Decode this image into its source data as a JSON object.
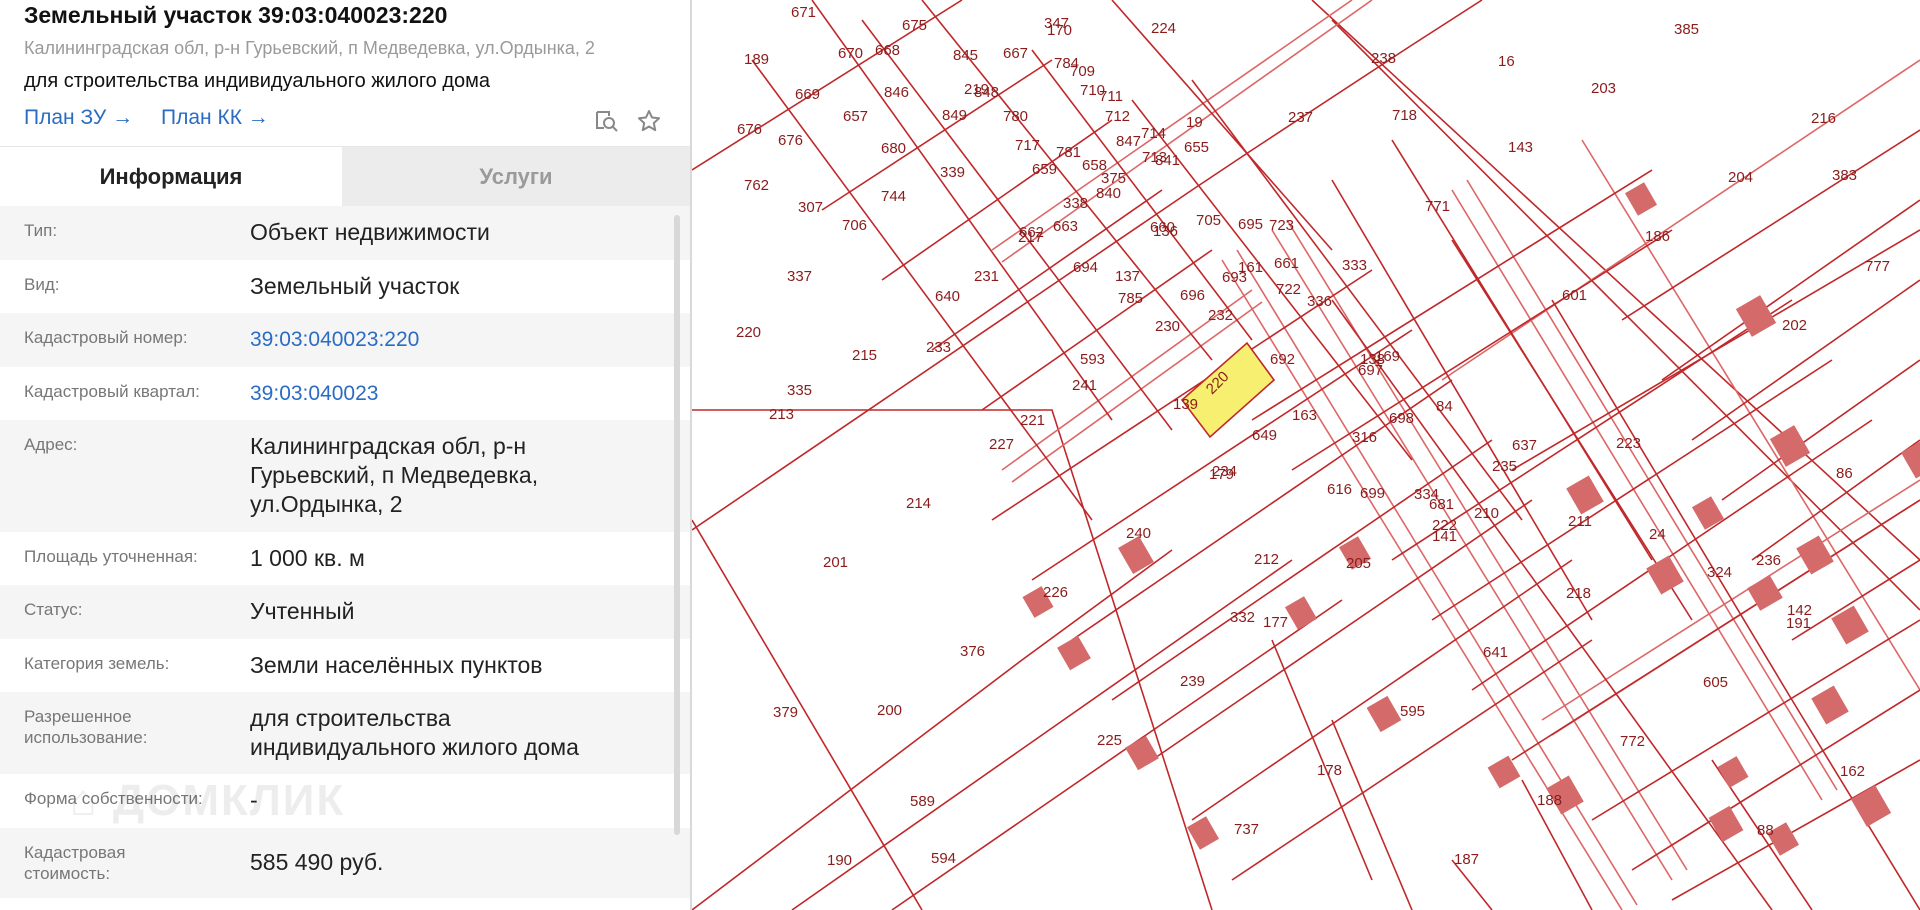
{
  "header": {
    "title": "Земельный участок 39:03:040023:220",
    "address": "Калининградская обл, р-н Гурьевский, п Медведевка, ул.Ордынка, 2",
    "purpose": "для строительства индивидуального жилого дома",
    "plan_zu": "План ЗУ",
    "plan_kk": "План КК"
  },
  "tabs": [
    "Информация",
    "Услуги"
  ],
  "info": [
    {
      "label": "Тип:",
      "value": "Объект недвижимости"
    },
    {
      "label": "Вид:",
      "value": "Земельный участок"
    },
    {
      "label": "Кадастровый номер:",
      "value": "39:03:040023:220"
    },
    {
      "label": "Кадастровый квартал:",
      "value": "39:03:040023"
    },
    {
      "label": "Адрес:",
      "value": "Калининградская обл, р-н Гурьевский, п Медведевка, ул.Ордынка, 2"
    },
    {
      "label": "Площадь уточненная:",
      "value": "1 000 кв. м"
    },
    {
      "label": "Статус:",
      "value": "Учтенный"
    },
    {
      "label": "Категория земель:",
      "value": "Земли населённых пунктов"
    },
    {
      "label": "Разрешенное использование:",
      "value": "для строительства индивидуального жилого дома"
    },
    {
      "label": "Форма собственности:",
      "value": "-"
    },
    {
      "label": "Кадастровая стоимость:",
      "value": "585 490 руб."
    }
  ],
  "watermark": "ДОМКЛИК",
  "icons": [
    "search-doc-icon",
    "star-icon",
    "arrow-right-icon"
  ],
  "colors": {
    "link": "#2a6cc4",
    "boundary": "#c0282a",
    "highlight": "#f7ef6f"
  },
  "map": {
    "selected": "220",
    "plots": [
      "671",
      "675",
      "347",
      "670",
      "668",
      "845",
      "667",
      "784",
      "709",
      "16",
      "669",
      "846",
      "848",
      "710",
      "711",
      "19",
      "676",
      "676",
      "657",
      "849",
      "780",
      "712",
      "714",
      "847",
      "717",
      "781",
      "713",
      "655",
      "658",
      "841",
      "718",
      "762",
      "339",
      "659",
      "840",
      "744",
      "706",
      "660",
      "663",
      "705",
      "338",
      "136",
      "662",
      "695",
      "723",
      "722",
      "337",
      "231",
      "137",
      "694",
      "383",
      "661",
      "693",
      "696",
      "785",
      "336",
      "232",
      "138",
      "692",
      "697",
      "220",
      "233",
      "593",
      "139",
      "649",
      "316",
      "698",
      "335",
      "221",
      "234",
      "616",
      "84",
      "699",
      "334",
      "210",
      "222",
      "235",
      "594",
      "141",
      "324",
      "333",
      "211",
      "223",
      "236",
      "142",
      "200",
      "212",
      "224",
      "237",
      "771",
      "601",
      "332",
      "86",
      "201",
      "376",
      "225",
      "737",
      "238",
      "143",
      "186",
      "202",
      "213",
      "214",
      "226",
      "239",
      "178",
      "187",
      "203",
      "204",
      "777",
      "215",
      "227",
      "240",
      "177",
      "595",
      "188",
      "385",
      "216",
      "307",
      "640",
      "241",
      "179",
      "205",
      "641",
      "772",
      "88",
      "189",
      "680",
      "217",
      "230",
      "163",
      "681",
      "218",
      "605",
      "162",
      "190",
      "219",
      "375",
      "161",
      "169",
      "637",
      "24",
      "191",
      "379",
      "589",
      "170"
    ]
  }
}
